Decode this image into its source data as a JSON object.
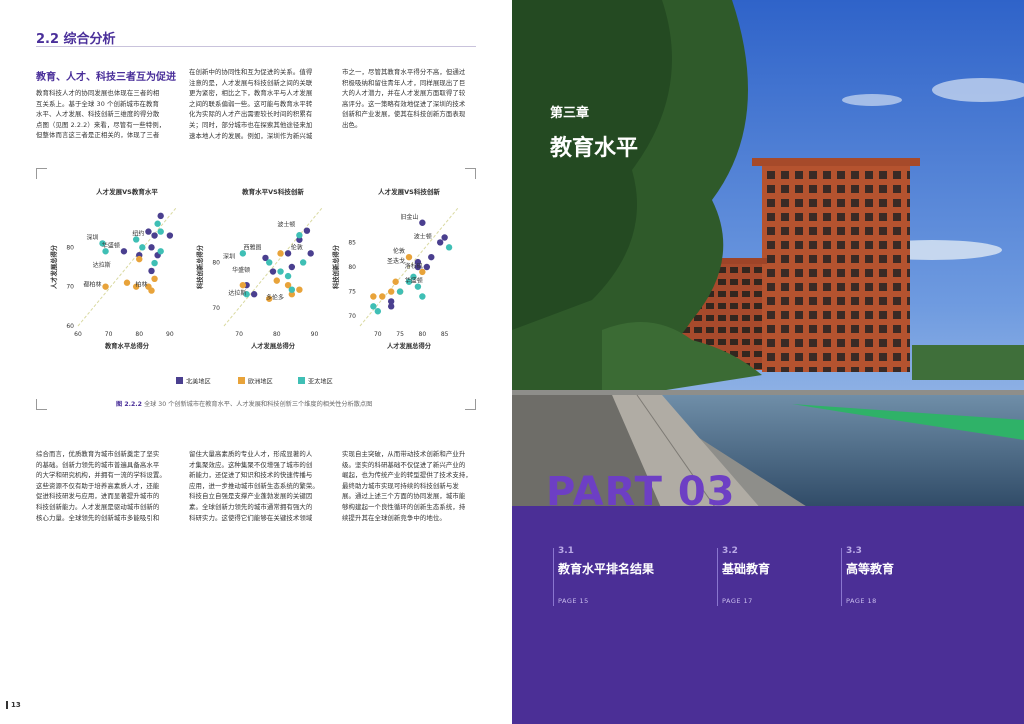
{
  "left": {
    "section_title": "2.2 综合分析",
    "subheading": "教育、人才、科技三者互为促进",
    "col1_top": [
      "教育科技人才的协同发展也体现在三者的相",
      "互关系上。基于全球 30 个创新城市在教育",
      "水平、人才发展、科技创新三维度的得分散",
      "点图（见图 2.2.2）来看，尽管有一些特例，",
      "但整体而言这三者是正相关的，体现了三者"
    ],
    "col2_top": [
      "在创新中的协同性和互为促进的关系。值得",
      "注意的是，人才发展与科技创新之间的关联",
      "更为紧密，相比之下，教育水平与人才发展",
      "之间的联系偏弱一些。这可能与教育水平转",
      "化为实际的人才产出需要较长时间的积累有",
      "关；同时，部分城市也在探索其他途径来加",
      "速本地人才的发展。例如，深圳作为新兴城"
    ],
    "col3_top": [
      "市之一，尽管其教育水平得分不高，但通过",
      "积极吸纳和留住青年人才，同样展现出了巨",
      "大的人才潜力，并在人才发展方面取得了较",
      "高评分。这一策略有效地促进了深圳的技术",
      "创新和产业发展，使其在科技创新方面表现",
      "出色。"
    ],
    "col1_bottom": [
      "综合而言，优质教育为城市创新奠定了坚实",
      "的基础。创新力领先的城市普遍具备高水平",
      "的大学和研究机构，并拥有一流的学科设置。",
      "这些资源不仅有助于培养高素质人才，还能",
      "促进科技研发与应用，进而显著提升城市的",
      "科技创新能力。人才发展是驱动城市创新的",
      "核心力量。全球领先的创新城市多能吸引和"
    ],
    "col2_bottom": [
      "留住大量高素质的专业人才，形成显著的人",
      "才集聚效应。这种集聚不仅增强了城市的创",
      "新能力，还促进了知识和技术的快速传播与",
      "应用，进一步推动城市创新生态系统的繁荣。",
      "科技自立自强是支撑产业蓬勃发展的关键因",
      "素。全球创新力领先的城市通常拥有强大的",
      "科研实力。这使得它们能够在关键技术领域"
    ],
    "col3_bottom": [
      "实现自主突破，从而带动技术创新和产业升",
      "级。坚实的科研基础不仅促进了新兴产业的",
      "崛起，也为传统产业的转型提供了技术支持，",
      "最终助力城市实现可持续的科技创新与发",
      "展。通过上述三个方面的协同发展，城市能",
      "够构建起一个良性循环的创新生态系统，持",
      "续提升其在全球创新竞争中的地位。"
    ],
    "figure_label": "图 2.2.2",
    "figure_caption": "全球 30 个创新城市在教育水平、人才发展和科技创新三个维度的相关性分析散点图",
    "page_number": "13"
  },
  "right": {
    "chapter_label": "第三章",
    "chapter_title": "教育水平",
    "part_label": "PART 03",
    "toc": [
      {
        "num": "3.1",
        "title": "教育水平排名结果",
        "page": "PAGE 15"
      },
      {
        "num": "3.2",
        "title": "基础教育",
        "page": "PAGE 17"
      },
      {
        "num": "3.3",
        "title": "高等教育",
        "page": "PAGE 18"
      }
    ]
  },
  "colors": {
    "na": "#4a3f8f",
    "eu": "#e8a33a",
    "ap": "#3fbfb5",
    "trend": "#d9d9a0",
    "accent": "#4a2f9a"
  },
  "chart_data": [
    {
      "type": "scatter",
      "title": "人才发展VS教育水平",
      "xlabel": "教育水平总得分",
      "ylabel": "人才发展总得分",
      "xlim": [
        60,
        92
      ],
      "ylim": [
        60,
        90
      ],
      "xticks": [
        60,
        70,
        80,
        90
      ],
      "yticks": [
        60,
        70,
        80
      ],
      "series": [
        {
          "name": "北美地区",
          "color_key": "na",
          "points": [
            [
              85,
              83
            ],
            [
              84,
              80
            ],
            [
              90,
              83
            ],
            [
              75,
              79
            ],
            [
              80,
              78
            ],
            [
              86,
              78
            ],
            [
              84,
              74
            ],
            [
              83,
              84
            ],
            [
              87,
              88
            ]
          ]
        },
        {
          "name": "欧洲地区",
          "color_key": "eu",
          "points": [
            [
              69,
              70
            ],
            [
              79,
              70
            ],
            [
              85,
              72
            ],
            [
              80,
              77
            ],
            [
              83,
              70
            ],
            [
              84,
              69
            ],
            [
              76,
              71
            ]
          ]
        },
        {
          "name": "亚太地区",
          "color_key": "ap",
          "points": [
            [
              68,
              81
            ],
            [
              69,
              79
            ],
            [
              81,
              80
            ],
            [
              86,
              86
            ],
            [
              85,
              76
            ],
            [
              79,
              82
            ],
            [
              87,
              84
            ],
            [
              87,
              79
            ]
          ]
        }
      ],
      "labels": [
        {
          "text": "深圳",
          "x": 68,
          "y": 81
        },
        {
          "text": "纽约",
          "x": 83,
          "y": 82
        },
        {
          "text": "华盛顿",
          "x": 75,
          "y": 79
        },
        {
          "text": "达拉斯",
          "x": 72,
          "y": 74
        },
        {
          "text": "都柏林",
          "x": 69,
          "y": 69
        },
        {
          "text": "柏林",
          "x": 84,
          "y": 69
        }
      ],
      "legend": [
        "北美地区",
        "欧洲地区",
        "亚太地区"
      ]
    },
    {
      "type": "scatter",
      "title": "教育水平VS科技创新",
      "xlabel": "人才发展总得分",
      "ylabel": "科技创新总得分",
      "xlim": [
        66,
        92
      ],
      "ylim": [
        66,
        92
      ],
      "xticks": [
        70,
        80,
        90
      ],
      "yticks": [
        70,
        80
      ],
      "series": [
        {
          "name": "北美地区",
          "color_key": "na",
          "points": [
            [
              88,
              87
            ],
            [
              89,
              82
            ],
            [
              72,
              75
            ],
            [
              79,
              78
            ],
            [
              77,
              81
            ],
            [
              83,
              82
            ],
            [
              84,
              79
            ],
            [
              74,
              73
            ],
            [
              86,
              85
            ]
          ]
        },
        {
          "name": "欧洲地区",
          "color_key": "eu",
          "points": [
            [
              71,
              75
            ],
            [
              80,
              76
            ],
            [
              83,
              75
            ],
            [
              78,
              72
            ],
            [
              84,
              73
            ],
            [
              86,
              74
            ],
            [
              81,
              82
            ]
          ]
        },
        {
          "name": "亚太地区",
          "color_key": "ap",
          "points": [
            [
              71,
              82
            ],
            [
              78,
              80
            ],
            [
              81,
              78
            ],
            [
              83,
              77
            ],
            [
              86,
              86
            ],
            [
              84,
              74
            ],
            [
              72,
              73
            ],
            [
              87,
              80
            ]
          ]
        }
      ],
      "labels": [
        {
          "text": "波士顿",
          "x": 86,
          "y": 87
        },
        {
          "text": "西雅图",
          "x": 77,
          "y": 82
        },
        {
          "text": "伦敦",
          "x": 88,
          "y": 82
        },
        {
          "text": "深圳",
          "x": 70,
          "y": 80
        },
        {
          "text": "华盛顿",
          "x": 74,
          "y": 77
        },
        {
          "text": "达拉斯",
          "x": 73,
          "y": 72
        },
        {
          "text": "多伦多",
          "x": 83,
          "y": 71
        }
      ]
    },
    {
      "type": "scatter",
      "title": "人才发展VS科技创新",
      "xlabel": "人才发展总得分",
      "ylabel": "科技创新总得分",
      "xlim": [
        66,
        88
      ],
      "ylim": [
        68,
        92
      ],
      "xticks": [
        70,
        75,
        80,
        85
      ],
      "yticks": [
        70,
        75,
        80,
        85
      ],
      "series": [
        {
          "name": "北美地区",
          "color_key": "na",
          "points": [
            [
              80,
              89
            ],
            [
              84,
              85
            ],
            [
              82,
              82
            ],
            [
              79,
              81
            ],
            [
              73,
              73
            ],
            [
              73,
              72
            ],
            [
              81,
              80
            ],
            [
              79,
              80
            ],
            [
              85,
              86
            ]
          ]
        },
        {
          "name": "欧洲地区",
          "color_key": "eu",
          "points": [
            [
              69,
              74
            ],
            [
              71,
              74
            ],
            [
              75,
              75
            ],
            [
              77,
              82
            ],
            [
              74,
              77
            ],
            [
              80,
              79
            ],
            [
              73,
              75
            ]
          ]
        },
        {
          "name": "亚太地区",
          "color_key": "ap",
          "points": [
            [
              69,
              72
            ],
            [
              77,
              77
            ],
            [
              78,
              78
            ],
            [
              80,
              74
            ],
            [
              86,
              84
            ],
            [
              75,
              75
            ],
            [
              70,
              71
            ],
            [
              79,
              76
            ]
          ]
        }
      ],
      "labels": [
        {
          "text": "旧金山",
          "x": 80,
          "y": 89
        },
        {
          "text": "波士顿",
          "x": 83,
          "y": 85
        },
        {
          "text": "伦敦",
          "x": 77,
          "y": 82
        },
        {
          "text": "圣迭戈",
          "x": 77,
          "y": 80
        },
        {
          "text": "洛杉矶",
          "x": 81,
          "y": 79
        },
        {
          "text": "华盛顿",
          "x": 81,
          "y": 76
        }
      ]
    }
  ]
}
